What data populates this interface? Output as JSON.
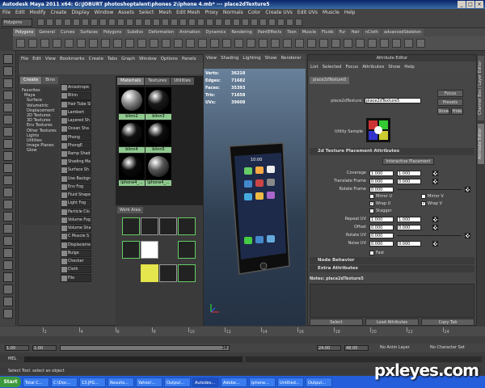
{
  "window": {
    "title": "Autodesk Maya 2011 x64: G:\\JOBURT photoshoptalent\\phones 2\\iphone 4.mb* --- place2dTexture5",
    "minimize": "_",
    "maximize": "□",
    "close": "×"
  },
  "menu": [
    "File",
    "Edit",
    "Modify",
    "Create",
    "Display",
    "Window",
    "Assets",
    "Select",
    "Mesh",
    "Edit Mesh",
    "Proxy",
    "Normals",
    "Color",
    "Create UVs",
    "Edit UVs",
    "Muscle",
    "Help"
  ],
  "status": {
    "mode": "Polygons"
  },
  "shelf_tabs": [
    "Polygons",
    "General",
    "Curves",
    "Surfaces",
    "Polygons",
    "Subdivs",
    "Deformation",
    "Animation",
    "Dynamics",
    "Rendering",
    "PaintEffects",
    "Toon",
    "Muscle",
    "Fluids",
    "Fur",
    "Hair",
    "nCloth",
    "advancedSkeleton"
  ],
  "hypershade": {
    "menu": [
      "File",
      "Edit",
      "View",
      "Bookmarks",
      "Create",
      "Tabs",
      "Graph",
      "Window",
      "Options",
      "Panels"
    ],
    "create_tabs": [
      "Create",
      "Bins"
    ],
    "tree": [
      "Favorites",
      "Maya",
      "Surface",
      "Volumetric",
      "Displacement",
      "2D Textures",
      "3D Textures",
      "Env Textures",
      "Other Textures",
      "Lights",
      "Utilities",
      "Image Planes",
      "Glow"
    ],
    "nodes": [
      "Anisotropic",
      "Blinn",
      "Hair Tube Sh",
      "Lambert",
      "Layered Sh",
      "Ocean Sha",
      "Phong",
      "PhongE",
      "Ramp Shade",
      "Shading Ma",
      "Surface Sh",
      "Use Backgro",
      "Env Fog",
      "Fluid Shape",
      "Light Fog",
      "Particle Clo",
      "Volume Fog",
      "Volume Sha",
      "C Muscle S",
      "Displacement",
      "Bulge",
      "Checker",
      "Cloth",
      "File"
    ],
    "swatch_tabs": [
      "Materials",
      "Textures",
      "Utilities"
    ],
    "swatches": [
      {
        "label": "blinn2",
        "color": "#888888"
      },
      {
        "label": "blinn3",
        "color": "#1a1a1a"
      },
      {
        "label": "blinn4",
        "color": "#111111"
      },
      {
        "label": "blinn5",
        "color": "#0d0d0d"
      },
      {
        "label": "iphone4_...",
        "color": "#0a0a0a"
      },
      {
        "label": "iphone4_...",
        "color": "#555555"
      }
    ],
    "work_area_label": "Work Area"
  },
  "viewport": {
    "menu": [
      "View",
      "Shading",
      "Lighting",
      "Show",
      "Renderer"
    ],
    "hud": [
      {
        "label": "Verts:",
        "value": "36218"
      },
      {
        "label": "Edges:",
        "value": "71682"
      },
      {
        "label": "Faces:",
        "value": "35393"
      },
      {
        "label": "Tris:",
        "value": "71658"
      },
      {
        "label": "UVs:",
        "value": "39608"
      }
    ],
    "screen_time": "10:00"
  },
  "attribute_editor": {
    "title": "Attribute Editor",
    "menu": [
      "List",
      "Selected",
      "Focus",
      "Attributes",
      "Show",
      "Help"
    ],
    "tab": "place2dTexture5",
    "node_label": "place2dTexture:",
    "node_value": "place2dTexture5",
    "focus": "Focus",
    "presets": "Presets",
    "show": "Show",
    "hide": "Hide",
    "utility_sample": "Utility Sample",
    "section_title": "2d Texture Placement Attributes",
    "interactive_placement": "Interactive Placement",
    "fields": [
      {
        "label": "Coverage",
        "v1": "1.000",
        "v2": "1.000"
      },
      {
        "label": "Translate Frame",
        "v1": "0.000",
        "v2": "0.000"
      },
      {
        "label": "Rotate Frame",
        "v1": "0.000",
        "v2": ""
      }
    ],
    "checks": [
      {
        "label": "Mirror U",
        "checked": false
      },
      {
        "label": "Mirror V",
        "checked": false
      },
      {
        "label": "Wrap U",
        "checked": true
      },
      {
        "label": "Wrap V",
        "checked": true
      },
      {
        "label": "Stagger",
        "checked": false
      }
    ],
    "fields2": [
      {
        "label": "Repeat UV",
        "v1": "1.000",
        "v2": "1.000"
      },
      {
        "label": "Offset",
        "v1": "0.000",
        "v2": "0.000"
      },
      {
        "label": "Rotate UV",
        "v1": "0.000",
        "v2": ""
      },
      {
        "label": "Noise UV",
        "v1": "0.000",
        "v2": "0.000"
      }
    ],
    "fast": "Fast",
    "node_behavior": "Node Behavior",
    "extra_attributes": "Extra Attributes",
    "notes": "Notes: place2dTexture5",
    "buttons": [
      "Select",
      "Load Attributes",
      "Copy Tab"
    ]
  },
  "side_tabs": [
    "Channel Box / Layer Editor",
    "Attribute Editor"
  ],
  "timeline": {
    "ticks": [
      "2",
      "4",
      "6",
      "8",
      "10",
      "12",
      "14",
      "16",
      "18",
      "20",
      "22",
      "24"
    ]
  },
  "range": {
    "start": "1.00",
    "inner_start": "1.00",
    "inner_end": "24",
    "end_a": "24.00",
    "end_b": "48.00",
    "anim_layer": "No Anim Layer",
    "char_set": "No Character Set"
  },
  "mel_label": "MEL",
  "help_text": "Select Tool: select an object",
  "taskbar": {
    "start": "Start",
    "tasks": [
      "Total C...",
      "C:\\Doc...",
      "13.JPG...",
      "Results...",
      "Yahoo!...",
      "Output...",
      "Autodes...",
      "Adobe...",
      "iphone...",
      "Untitled...",
      "Output..."
    ]
  },
  "watermark": "pxleyes.com",
  "colors": {
    "title_blue": "#0a246a",
    "swatch_label": "#8fc98f",
    "taskbar": "#245edb"
  }
}
